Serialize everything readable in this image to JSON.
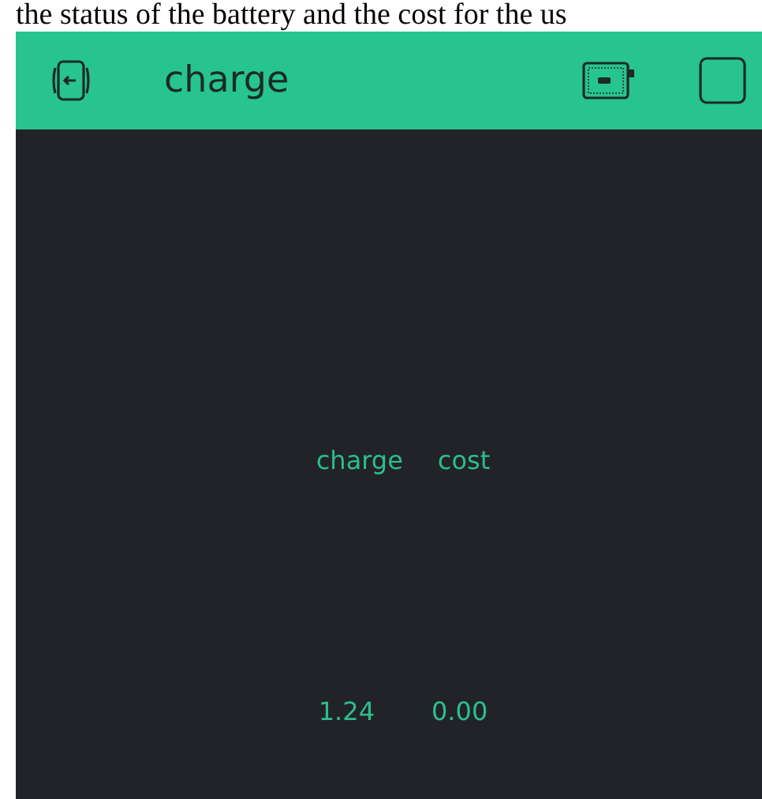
{
  "document_text": "the status of the battery and the cost for the us",
  "app_bar": {
    "title": "charge"
  },
  "labels": [
    {
      "text": "charge"
    },
    {
      "text": "cost"
    }
  ],
  "values": [
    {
      "text": "1.24"
    },
    {
      "text": "0.00"
    }
  ]
}
